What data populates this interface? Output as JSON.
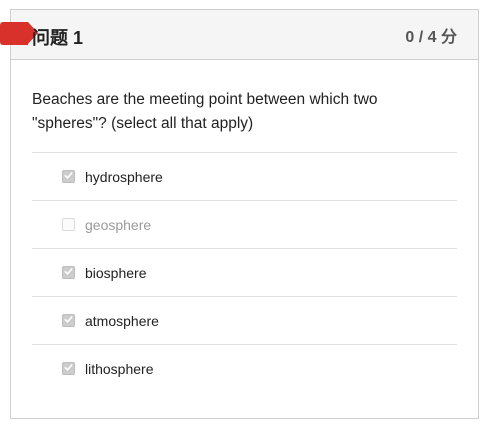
{
  "question": {
    "title": "问题 1",
    "score": "0 / 4 分",
    "text": "Beaches are the meeting point between which two \"spheres\"? (select all that apply)",
    "flag_color": "#d8312b",
    "options": [
      {
        "label": "hydrosphere",
        "checked": true
      },
      {
        "label": "geosphere",
        "checked": false
      },
      {
        "label": "biosphere",
        "checked": true
      },
      {
        "label": "atmosphere",
        "checked": true
      },
      {
        "label": "lithosphere",
        "checked": true
      }
    ]
  }
}
